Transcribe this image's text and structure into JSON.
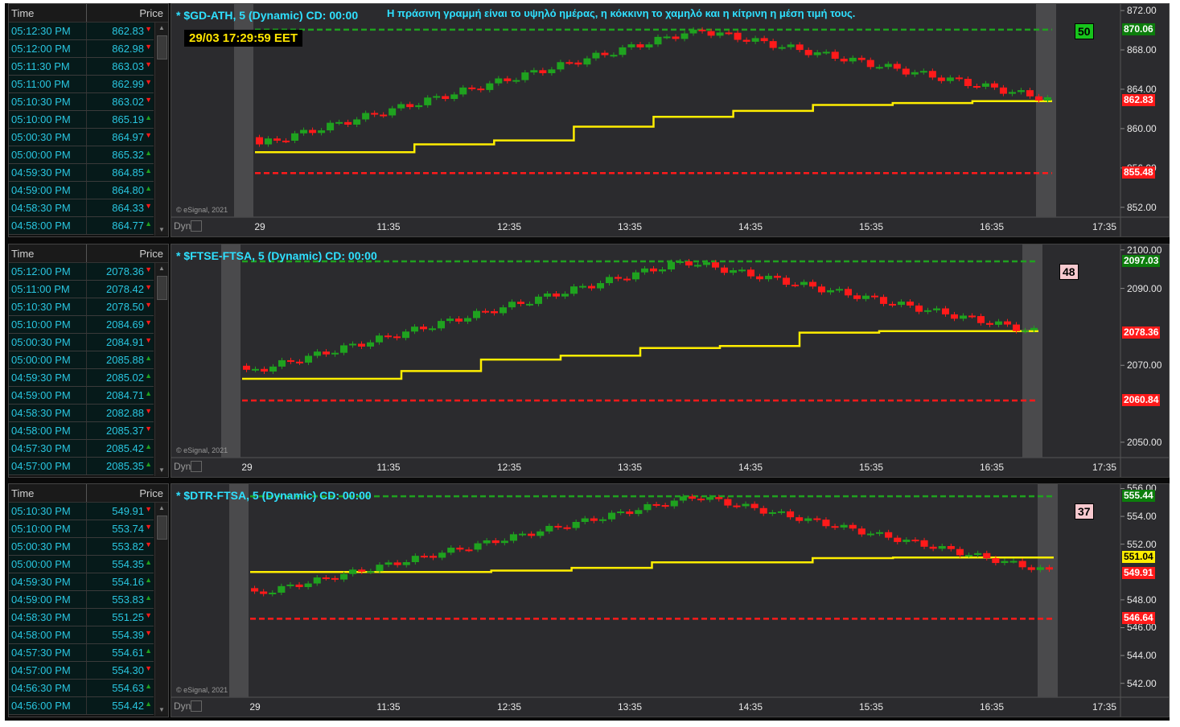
{
  "panels": [
    {
      "title": "* $GD-ATH, 5 (Dynamic) CD: 00:00",
      "note": "Η πράσινη γραμμή είναι το υψηλό ημέρας, η κόκκινη το χαμηλό και η κίτρινη η μέση τιμή τους.",
      "clock": "29/03 17:29:59 EET",
      "badge": "50",
      "badge_color": "#17c41c",
      "copyright": "© eSignal, 2021",
      "dyn": "Dyn",
      "ts_header": {
        "time": "Time",
        "price": "Price"
      },
      "trades": [
        {
          "time": "05:12:30 PM",
          "price": "862.83",
          "dir": "down"
        },
        {
          "time": "05:12:00 PM",
          "price": "862.98",
          "dir": "down"
        },
        {
          "time": "05:11:30 PM",
          "price": "863.03",
          "dir": "down"
        },
        {
          "time": "05:11:00 PM",
          "price": "862.99",
          "dir": "down"
        },
        {
          "time": "05:10:30 PM",
          "price": "863.02",
          "dir": "down"
        },
        {
          "time": "05:10:00 PM",
          "price": "865.19",
          "dir": "up"
        },
        {
          "time": "05:00:30 PM",
          "price": "864.97",
          "dir": "down"
        },
        {
          "time": "05:00:00 PM",
          "price": "865.32",
          "dir": "up"
        },
        {
          "time": "04:59:30 PM",
          "price": "864.85",
          "dir": "up"
        },
        {
          "time": "04:59:00 PM",
          "price": "864.80",
          "dir": "up"
        },
        {
          "time": "04:58:30 PM",
          "price": "864.33",
          "dir": "down"
        },
        {
          "time": "04:58:00 PM",
          "price": "864.77",
          "dir": "up"
        }
      ],
      "y_ticks": [
        "872.00",
        "868.00",
        "864.00",
        "860.00",
        "856.00",
        "852.00"
      ],
      "x_ticks": [
        "29",
        "11:35",
        "12:35",
        "13:35",
        "14:35",
        "15:35",
        "16:35",
        "17:35"
      ],
      "price_tags": {
        "high": "870.06",
        "last": "862.83",
        "low": "855.48"
      },
      "chart_data": {
        "type": "line",
        "ylim": [
          851,
          872.5
        ],
        "y_ticks": [
          872,
          868,
          864,
          860,
          856,
          852
        ],
        "x_ticks": [
          "29",
          "11:35",
          "12:35",
          "13:35",
          "14:35",
          "15:35",
          "16:35",
          "17:35"
        ],
        "high": 870.06,
        "low": 855.48,
        "last": 862.83,
        "mid": [
          857.6,
          857.6,
          858.4,
          858.8,
          860.2,
          861.2,
          861.8,
          862.4,
          862.6,
          862.8
        ]
      }
    },
    {
      "title": "* $FTSE-FTSA, 5 (Dynamic) CD: 00:00",
      "badge": "48",
      "badge_color": "#f7c9cf",
      "copyright": "© eSignal, 2021",
      "dyn": "Dyn",
      "ts_header": {
        "time": "Time",
        "price": "Price"
      },
      "trades": [
        {
          "time": "05:12:00 PM",
          "price": "2078.36",
          "dir": "down"
        },
        {
          "time": "05:11:00 PM",
          "price": "2078.42",
          "dir": "down"
        },
        {
          "time": "05:10:30 PM",
          "price": "2078.50",
          "dir": "down"
        },
        {
          "time": "05:10:00 PM",
          "price": "2084.69",
          "dir": "down"
        },
        {
          "time": "05:00:30 PM",
          "price": "2084.91",
          "dir": "down"
        },
        {
          "time": "05:00:00 PM",
          "price": "2085.88",
          "dir": "up"
        },
        {
          "time": "04:59:30 PM",
          "price": "2085.02",
          "dir": "up"
        },
        {
          "time": "04:59:00 PM",
          "price": "2084.71",
          "dir": "up"
        },
        {
          "time": "04:58:30 PM",
          "price": "2082.88",
          "dir": "down"
        },
        {
          "time": "04:58:00 PM",
          "price": "2085.37",
          "dir": "down"
        },
        {
          "time": "04:57:30 PM",
          "price": "2085.42",
          "dir": "up"
        },
        {
          "time": "04:57:00 PM",
          "price": "2085.35",
          "dir": "up"
        }
      ],
      "y_ticks": [
        "2100.00",
        "2090.00",
        "2070.00",
        "2050.00"
      ],
      "x_ticks": [
        "29",
        "11:35",
        "12:35",
        "13:35",
        "14:35",
        "15:35",
        "16:35",
        "17:35"
      ],
      "price_tags": {
        "high": "2097.03",
        "last": "2078.36",
        "low": "2060.84"
      },
      "chart_data": {
        "type": "line",
        "ylim": [
          2046,
          2101
        ],
        "y_ticks": [
          2100,
          2090,
          2070,
          2050
        ],
        "x_ticks": [
          "29",
          "11:35",
          "12:35",
          "13:35",
          "14:35",
          "15:35",
          "16:35",
          "17:35"
        ],
        "high": 2097.03,
        "low": 2060.84,
        "last": 2078.36,
        "mid": [
          2066.5,
          2066.5,
          2068.5,
          2071.5,
          2072.5,
          2074.5,
          2075.0,
          2078.5,
          2078.9,
          2078.9
        ]
      }
    },
    {
      "title": "* $DTR-FTSA, 5 (Dynamic) CD: 00:00",
      "badge": "37",
      "badge_color": "#f7c9cf",
      "copyright": "© eSignal, 2021",
      "dyn": "Dyn",
      "ts_header": {
        "time": "Time",
        "price": "Price"
      },
      "trades": [
        {
          "time": "05:10:30 PM",
          "price": "549.91",
          "dir": "down"
        },
        {
          "time": "05:10:00 PM",
          "price": "553.74",
          "dir": "down"
        },
        {
          "time": "05:00:30 PM",
          "price": "553.82",
          "dir": "down"
        },
        {
          "time": "05:00:00 PM",
          "price": "554.35",
          "dir": "up"
        },
        {
          "time": "04:59:30 PM",
          "price": "554.16",
          "dir": "up"
        },
        {
          "time": "04:59:00 PM",
          "price": "553.83",
          "dir": "up"
        },
        {
          "time": "04:58:30 PM",
          "price": "551.25",
          "dir": "down"
        },
        {
          "time": "04:58:00 PM",
          "price": "554.39",
          "dir": "down"
        },
        {
          "time": "04:57:30 PM",
          "price": "554.61",
          "dir": "up"
        },
        {
          "time": "04:57:00 PM",
          "price": "554.30",
          "dir": "down"
        },
        {
          "time": "04:56:30 PM",
          "price": "554.63",
          "dir": "up"
        },
        {
          "time": "04:56:00 PM",
          "price": "554.42",
          "dir": "up"
        }
      ],
      "y_ticks": [
        "556.00",
        "554.00",
        "552.00",
        "548.00",
        "546.00",
        "544.00",
        "542.00"
      ],
      "x_ticks": [
        "29",
        "11:35",
        "12:35",
        "13:35",
        "14:35",
        "15:35",
        "16:35",
        "17:35"
      ],
      "price_tags": {
        "high": "555.44",
        "mid": "551.04",
        "last": "549.91",
        "low": "546.64"
      },
      "chart_data": {
        "type": "line",
        "ylim": [
          541,
          556.2
        ],
        "y_ticks": [
          556,
          554,
          552,
          548,
          546,
          544,
          542
        ],
        "x_ticks": [
          "29",
          "11:35",
          "12:35",
          "13:35",
          "14:35",
          "15:35",
          "16:35",
          "17:35"
        ],
        "high": 555.44,
        "low": 546.64,
        "last": 549.91,
        "mid": [
          550.0,
          550.0,
          550.0,
          550.1,
          550.3,
          550.7,
          550.7,
          551.0,
          551.04,
          551.04
        ]
      }
    }
  ],
  "colors": {
    "high": "#1fa21f",
    "low": "#ff1a1a",
    "mid": "#ffee00",
    "up_candle": "#1fa21f",
    "down_candle": "#ff1a1a",
    "title": "#2fe0ff",
    "ts_text": "#29c6e0"
  }
}
